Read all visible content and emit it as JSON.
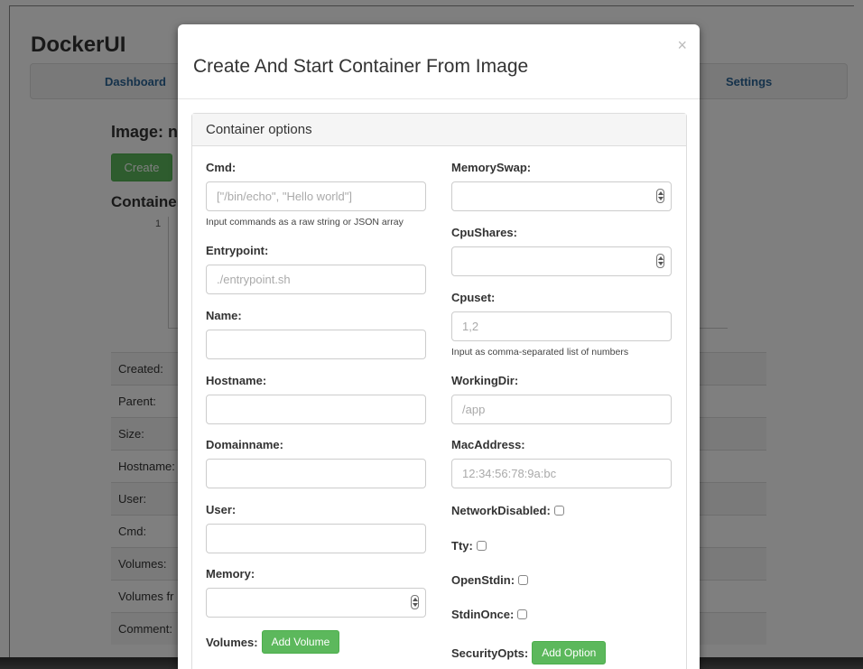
{
  "app": {
    "brand": "DockerUI"
  },
  "nav": {
    "dashboard": "Dashboard",
    "settings": "Settings"
  },
  "background": {
    "image_title": "Image: ng",
    "create_label": "Create",
    "containers_title": "Container",
    "chart_count": "1",
    "info_rows": [
      "Created:",
      "Parent:",
      "Size:",
      "Hostname:",
      "User:",
      "Cmd:",
      "Volumes:",
      "Volumes fr",
      "Comment:"
    ]
  },
  "modal": {
    "title": "Create And Start Container From Image",
    "close": "×",
    "panel_title": "Container options",
    "left": {
      "cmd": {
        "label": "Cmd:",
        "placeholder": "[\"/bin/echo\", \"Hello world\"]",
        "help": "Input commands as a raw string or JSON array"
      },
      "entrypoint": {
        "label": "Entrypoint:",
        "placeholder": "./entrypoint.sh"
      },
      "name": {
        "label": "Name:",
        "placeholder": ""
      },
      "hostname": {
        "label": "Hostname:",
        "placeholder": ""
      },
      "domainname": {
        "label": "Domainname:",
        "placeholder": ""
      },
      "user": {
        "label": "User:",
        "placeholder": ""
      },
      "memory": {
        "label": "Memory:"
      },
      "volumes": {
        "label": "Volumes:",
        "button": "Add Volume"
      }
    },
    "right": {
      "memoryswap": {
        "label": "MemorySwap:"
      },
      "cpushares": {
        "label": "CpuShares:"
      },
      "cpuset": {
        "label": "Cpuset:",
        "placeholder": "1,2",
        "help": "Input as comma-separated list of numbers"
      },
      "workingdir": {
        "label": "WorkingDir:",
        "placeholder": "/app"
      },
      "macaddress": {
        "label": "MacAddress:",
        "placeholder": "12:34:56:78:9a:bc"
      },
      "networkdisabled": {
        "label": "NetworkDisabled:"
      },
      "tty": {
        "label": "Tty:"
      },
      "openstdin": {
        "label": "OpenStdin:"
      },
      "stdinonce": {
        "label": "StdinOnce:"
      },
      "securityopts": {
        "label": "SecurityOpts:",
        "button": "Add Option"
      }
    }
  }
}
